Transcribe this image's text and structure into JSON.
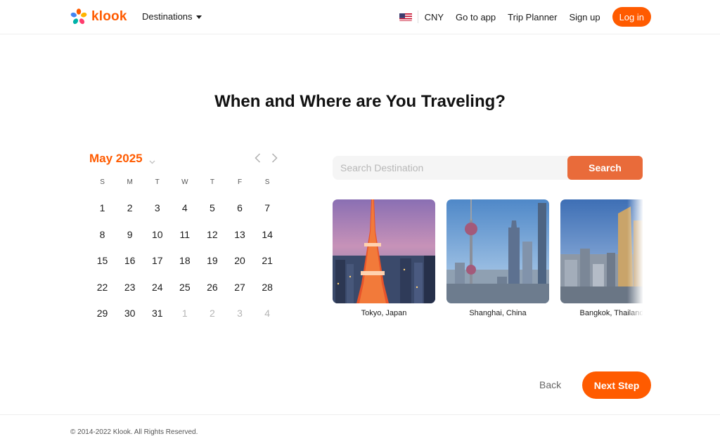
{
  "header": {
    "logo_text": "klook",
    "destinations_label": "Destinations",
    "currency": "CNY",
    "go_to_app": "Go to app",
    "trip_planner": "Trip Planner",
    "sign_up": "Sign up",
    "log_in": "Log in",
    "flag_icon": "us-flag-icon"
  },
  "main": {
    "title": "When and Where are You Traveling?"
  },
  "calendar": {
    "month_label": "May 2025",
    "weekdays": [
      "S",
      "M",
      "T",
      "W",
      "T",
      "F",
      "S"
    ],
    "days": [
      {
        "label": "1",
        "muted": false
      },
      {
        "label": "2",
        "muted": false
      },
      {
        "label": "3",
        "muted": false
      },
      {
        "label": "4",
        "muted": false
      },
      {
        "label": "5",
        "muted": false
      },
      {
        "label": "6",
        "muted": false
      },
      {
        "label": "7",
        "muted": false
      },
      {
        "label": "8",
        "muted": false
      },
      {
        "label": "9",
        "muted": false
      },
      {
        "label": "10",
        "muted": false
      },
      {
        "label": "11",
        "muted": false
      },
      {
        "label": "12",
        "muted": false
      },
      {
        "label": "13",
        "muted": false
      },
      {
        "label": "14",
        "muted": false
      },
      {
        "label": "15",
        "muted": false
      },
      {
        "label": "16",
        "muted": false
      },
      {
        "label": "17",
        "muted": false
      },
      {
        "label": "18",
        "muted": false
      },
      {
        "label": "19",
        "muted": false
      },
      {
        "label": "20",
        "muted": false
      },
      {
        "label": "21",
        "muted": false
      },
      {
        "label": "22",
        "muted": false
      },
      {
        "label": "23",
        "muted": false
      },
      {
        "label": "24",
        "muted": false
      },
      {
        "label": "25",
        "muted": false
      },
      {
        "label": "26",
        "muted": false
      },
      {
        "label": "27",
        "muted": false
      },
      {
        "label": "28",
        "muted": false
      },
      {
        "label": "29",
        "muted": false
      },
      {
        "label": "30",
        "muted": false
      },
      {
        "label": "31",
        "muted": false
      },
      {
        "label": "1",
        "muted": true
      },
      {
        "label": "2",
        "muted": true
      },
      {
        "label": "3",
        "muted": true
      },
      {
        "label": "4",
        "muted": true
      }
    ]
  },
  "search": {
    "placeholder": "Search Destination",
    "value": "",
    "button_label": "Search"
  },
  "destinations": [
    {
      "label": "Tokyo, Japan"
    },
    {
      "label": "Shanghai, China"
    },
    {
      "label": "Bangkok, Thailand"
    }
  ],
  "actions": {
    "back_label": "Back",
    "next_label": "Next Step"
  },
  "footer": {
    "copyright": "© 2014-2022 Klook. All Rights Reserved."
  },
  "colors": {
    "brand": "#ff5b00",
    "search_button": "#e96b3a",
    "muted_day": "#b5b5b5"
  }
}
